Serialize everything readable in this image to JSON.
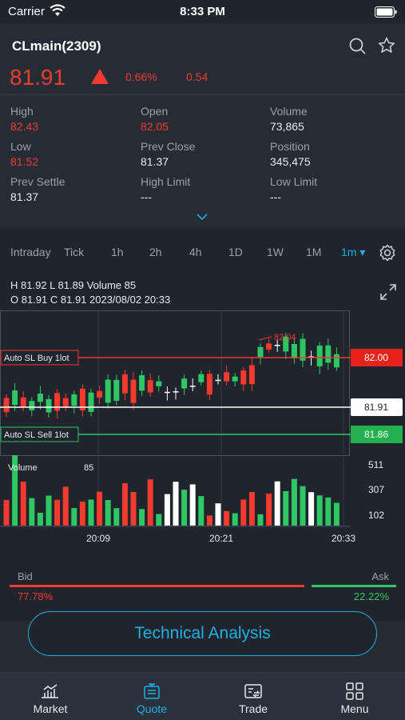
{
  "status_bar": {
    "carrier": "Carrier",
    "time": "8:33 PM"
  },
  "quote": {
    "symbol": "CLmain(2309)",
    "last_price": "81.91",
    "change_pct": "0.66%",
    "change": "0.54",
    "direction": "up"
  },
  "stats": {
    "high": {
      "label": "High",
      "value": "82.43"
    },
    "open": {
      "label": "Open",
      "value": "82.05"
    },
    "volume": {
      "label": "Volume",
      "value": "73,865"
    },
    "low": {
      "label": "Low",
      "value": "81.52"
    },
    "prev_close": {
      "label": "Prev Close",
      "value": "81.37"
    },
    "position": {
      "label": "Position",
      "value": "345,475"
    },
    "prev_settle": {
      "label": "Prev Settle",
      "value": "81.37"
    },
    "high_limit": {
      "label": "High Limit",
      "value": "---"
    },
    "low_limit": {
      "label": "Low Limit",
      "value": "---"
    }
  },
  "periods": {
    "intraday": "Intraday",
    "tick": "Tick",
    "h1": "1h",
    "h2": "2h",
    "h4": "4h",
    "d1": "1D",
    "w1": "1W",
    "m1": "1M",
    "min1": "1m ▾"
  },
  "ohlc": {
    "line1": "H 81.92  L 81.89  Volume 85",
    "line2": "O 81.91  C 81.91  2023/08/02 20:33"
  },
  "chart_data": {
    "type": "candlestick",
    "price_labels": {
      "buy_sl": "82.00",
      "last": "81.91",
      "sell_sl": "81.86"
    },
    "annotations": {
      "buy_sl": "Auto SL Buy 1lot",
      "sell_sl": "Auto SL Sell 1lot",
      "peak": "82.04"
    },
    "volume_label": "Volume",
    "volume_current": "85",
    "volume_ticks": [
      "511",
      "307",
      "102"
    ],
    "x_ticks": [
      "20:09",
      "20:21",
      "20:33"
    ],
    "candles_color": [
      "red",
      "green",
      "red",
      "green",
      "green",
      "green",
      "red",
      "red",
      "green",
      "red",
      "green",
      "red",
      "green",
      "green",
      "red",
      "red",
      "green",
      "red",
      "green",
      "white",
      "white",
      "green",
      "white",
      "green",
      "red",
      "white",
      "red",
      "green",
      "red",
      "red",
      "green",
      "red",
      "white",
      "green",
      "green",
      "green",
      "white",
      "green",
      "green",
      "green"
    ]
  },
  "bidask": {
    "bid_label": "Bid",
    "ask_label": "Ask",
    "bid_pct": "77.78%",
    "ask_pct": "22.22%"
  },
  "technical_analysis": "Technical Analysis",
  "tabs": {
    "market": "Market",
    "quote": "Quote",
    "trade": "Trade",
    "menu": "Menu"
  },
  "colors": {
    "up": "#f23a2f",
    "down": "#2fc764",
    "accent": "#1fb0e3",
    "bg": "#1f242d"
  }
}
